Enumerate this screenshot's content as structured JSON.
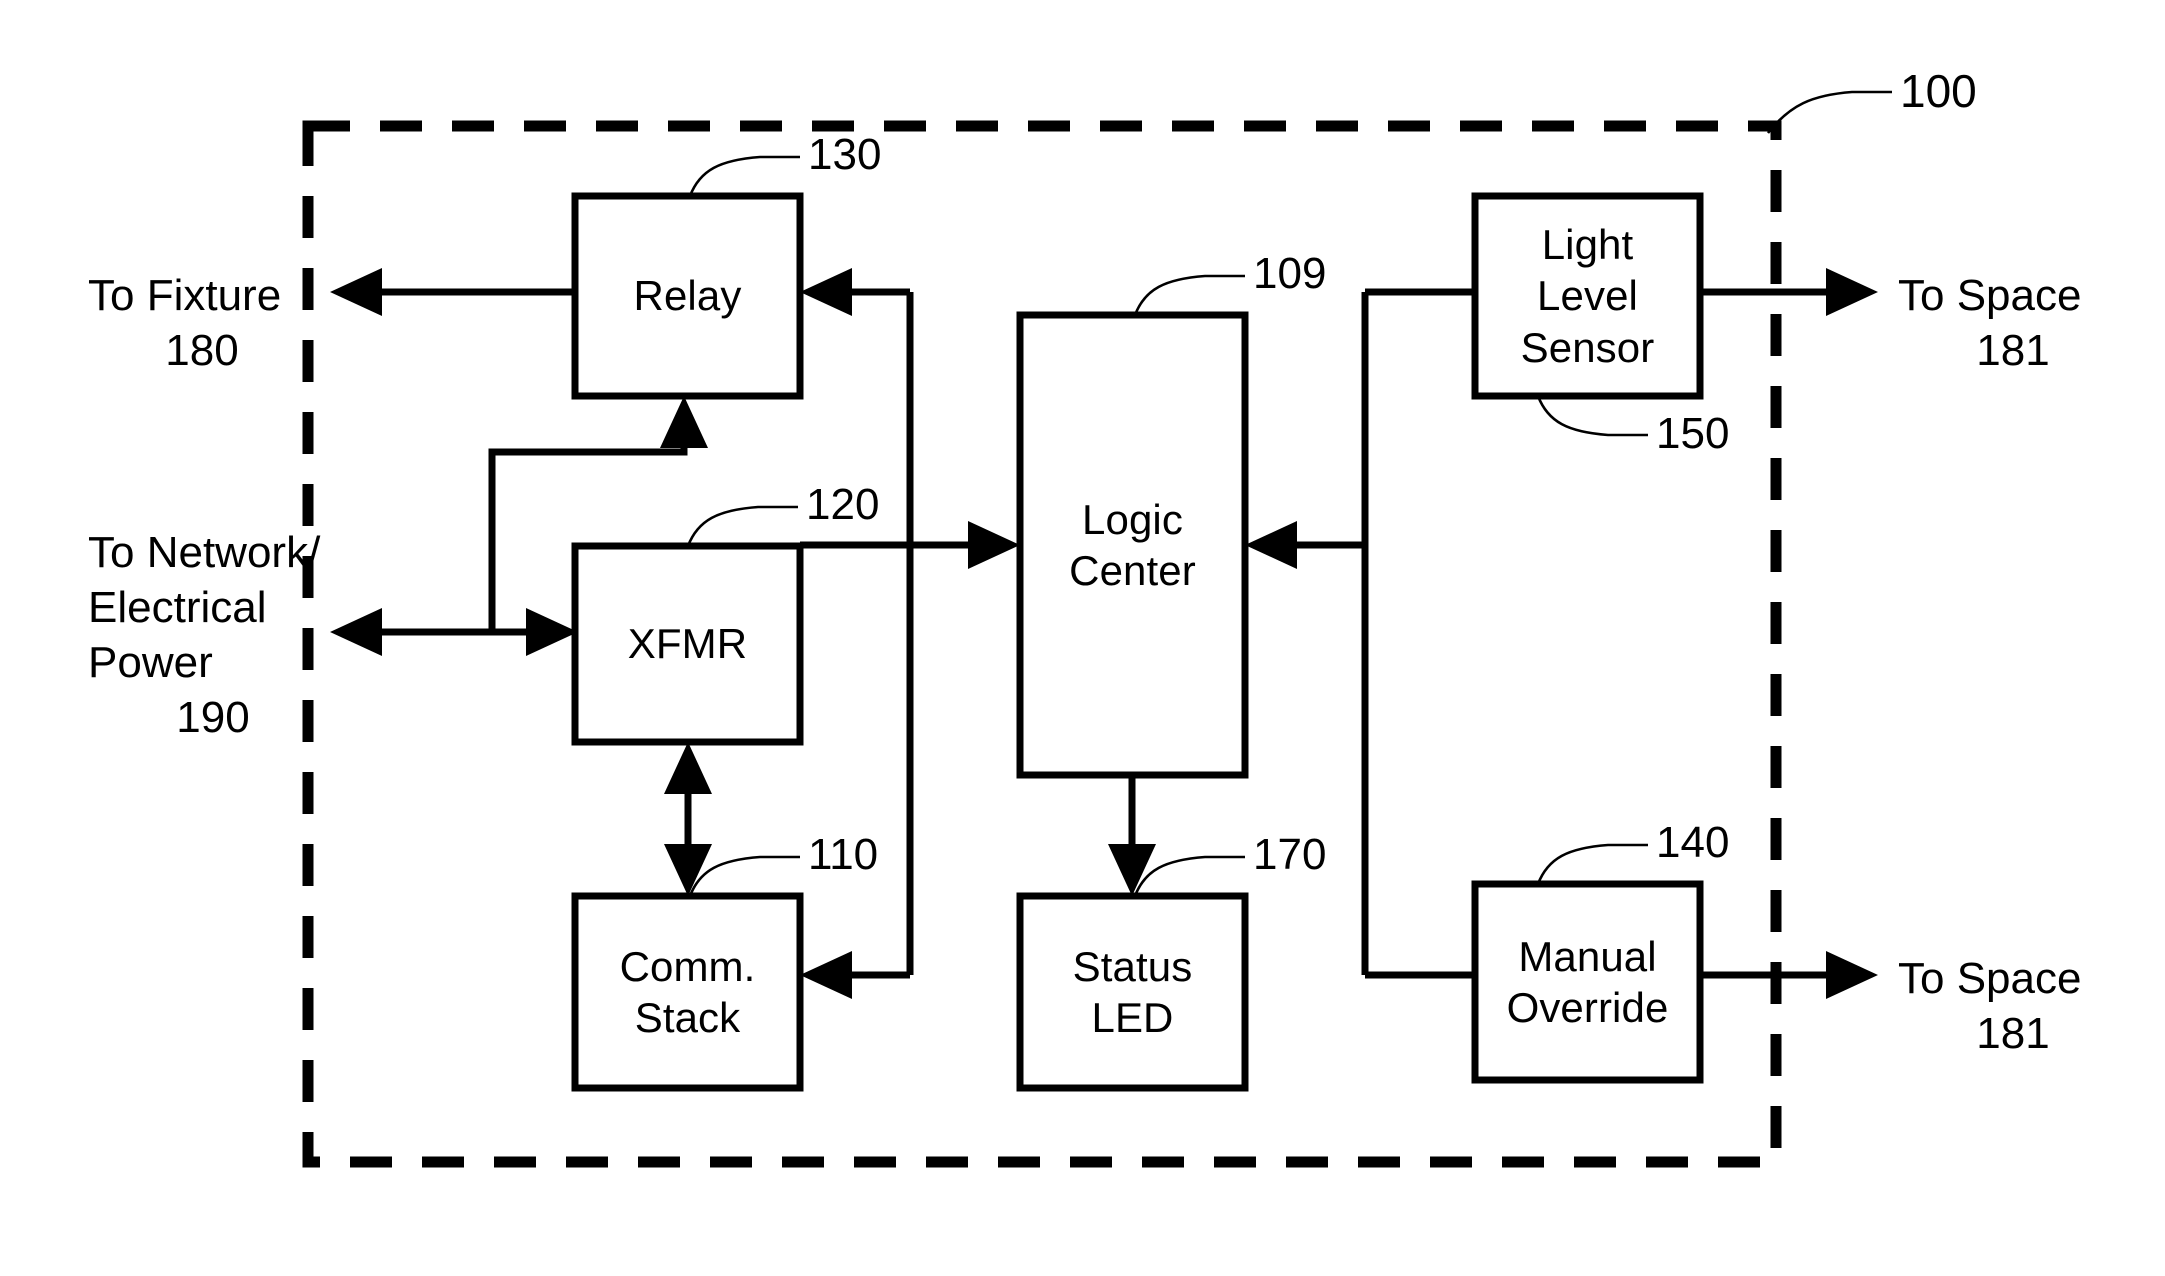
{
  "figure": {
    "system_ref": "100",
    "boundary_style": "dashed"
  },
  "blocks": [
    {
      "id": "relay",
      "label_lines": [
        "Relay"
      ],
      "ref": "130"
    },
    {
      "id": "xfmr",
      "label_lines": [
        "XFMR"
      ],
      "ref": "120"
    },
    {
      "id": "comm",
      "label_lines": [
        "Comm.",
        "Stack"
      ],
      "ref": "110"
    },
    {
      "id": "logic",
      "label_lines": [
        "Logic",
        "Center"
      ],
      "ref": "109"
    },
    {
      "id": "status",
      "label_lines": [
        "Status",
        "LED"
      ],
      "ref": "170"
    },
    {
      "id": "sensor",
      "label_lines": [
        "Light",
        "Level",
        "Sensor"
      ],
      "ref": "150"
    },
    {
      "id": "manual",
      "label_lines": [
        "Manual",
        "Override"
      ],
      "ref": "140"
    }
  ],
  "io_ports": [
    {
      "id": "to-fixture",
      "text_lines": [
        "To Fixture"
      ],
      "ref": "180",
      "side": "left"
    },
    {
      "id": "to-network",
      "text_lines": [
        "To Network/",
        "Electrical",
        "Power"
      ],
      "ref": "190",
      "side": "left"
    },
    {
      "id": "to-space-top",
      "text_lines": [
        "To Space"
      ],
      "ref": "181",
      "side": "right"
    },
    {
      "id": "to-space-bottom",
      "text_lines": [
        "To Space"
      ],
      "ref": "181",
      "side": "right"
    }
  ],
  "colors": {
    "line": "#000000",
    "background": "#ffffff",
    "text": "#000000"
  }
}
